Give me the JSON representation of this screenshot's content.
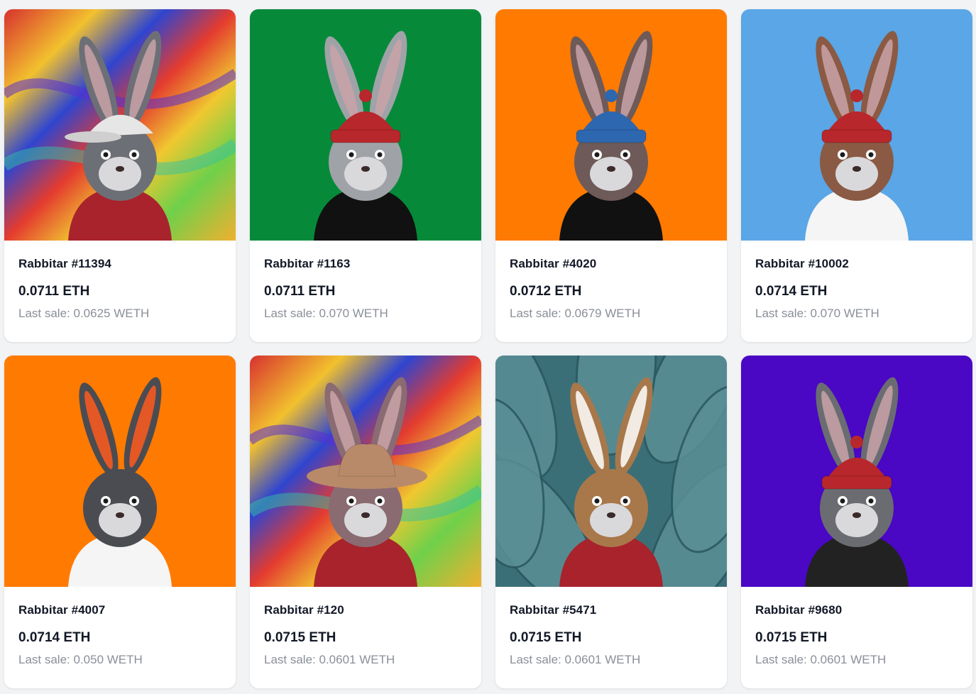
{
  "grid": {
    "last_sale_prefix": "Last sale:",
    "items": [
      {
        "name": "Rabbitar #11394",
        "price": "0.0711 ETH",
        "last_sale": "0.0625 WETH",
        "background": "rainbow",
        "bg_color": "#e9c032",
        "fur_color": "#6d6f76",
        "hat": "white-cap",
        "hat_color": "#e6e6e6",
        "shirt_color": "#a8232c"
      },
      {
        "name": "Rabbitar #1163",
        "price": "0.0711 ETH",
        "last_sale": "0.070 WETH",
        "background": "solid",
        "bg_color": "#068a3a",
        "fur_color": "#9fa3a8",
        "hat": "beanie",
        "hat_color": "#b8272b",
        "shirt_color": "#111111"
      },
      {
        "name": "Rabbitar #4020",
        "price": "0.0712 ETH",
        "last_sale": "0.0679 WETH",
        "background": "solid",
        "bg_color": "#ff7a00",
        "fur_color": "#6e5a58",
        "hat": "beanie",
        "hat_color": "#2d67b0",
        "shirt_color": "#111111"
      },
      {
        "name": "Rabbitar #10002",
        "price": "0.0714 ETH",
        "last_sale": "0.070 WETH",
        "background": "solid",
        "bg_color": "#5aa6e6",
        "fur_color": "#8a5a44",
        "hat": "beanie",
        "hat_color": "#b8272b",
        "shirt_color": "#f5f5f5"
      },
      {
        "name": "Rabbitar #4007",
        "price": "0.0714 ETH",
        "last_sale": "0.050 WETH",
        "background": "solid",
        "bg_color": "#ff7a00",
        "fur_color": "#4a4c52",
        "hat": "none",
        "hat_color": "#ff5a1f",
        "shirt_color": "#f5f5f5"
      },
      {
        "name": "Rabbitar #120",
        "price": "0.0715 ETH",
        "last_sale": "0.0601 WETH",
        "background": "rainbow",
        "bg_color": "#e9c032",
        "fur_color": "#8a6b72",
        "hat": "cowboy",
        "hat_color": "#b88a6a",
        "shirt_color": "#a8232c"
      },
      {
        "name": "Rabbitar #5471",
        "price": "0.0715 ETH",
        "last_sale": "0.0601 WETH",
        "background": "leaves",
        "bg_color": "#3b6f78",
        "fur_color": "#a8784a",
        "hat": "none",
        "hat_color": "#ffffff",
        "shirt_color": "#a8232c"
      },
      {
        "name": "Rabbitar #9680",
        "price": "0.0715 ETH",
        "last_sale": "0.0601 WETH",
        "background": "solid",
        "bg_color": "#4a07c4",
        "fur_color": "#6a6c72",
        "hat": "beanie",
        "hat_color": "#b8272b",
        "shirt_color": "#222222"
      }
    ]
  }
}
